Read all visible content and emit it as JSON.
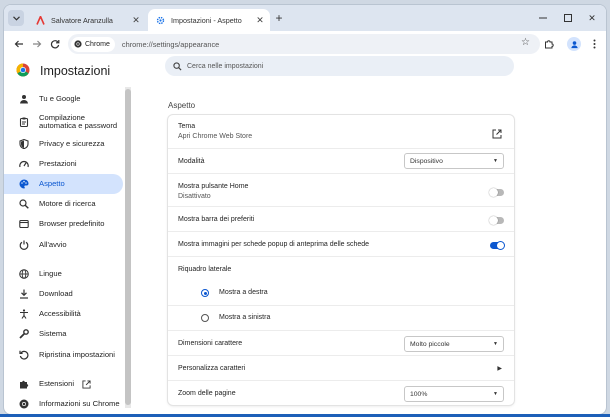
{
  "browser": {
    "tabs": [
      {
        "title": "Salvatore Aranzulla",
        "active": false
      },
      {
        "title": "Impostazioni - Aspetto",
        "active": true
      }
    ],
    "new_tab": "+",
    "address": {
      "chip_label": "Chrome",
      "url": "chrome://settings/appearance"
    }
  },
  "settings": {
    "app_title": "Impostazioni",
    "search_placeholder": "Cerca nelle impostazioni",
    "nav": [
      {
        "label": "Tu e Google",
        "icon": "person-icon"
      },
      {
        "label": "Compilazione automatica e password",
        "icon": "clipboard-icon"
      },
      {
        "label": "Privacy e sicurezza",
        "icon": "shield-icon"
      },
      {
        "label": "Prestazioni",
        "icon": "speedometer-icon"
      },
      {
        "label": "Aspetto",
        "icon": "palette-icon",
        "active": true
      },
      {
        "label": "Motore di ricerca",
        "icon": "search-icon"
      },
      {
        "label": "Browser predefinito",
        "icon": "browser-icon"
      },
      {
        "label": "All'avvio",
        "icon": "power-icon"
      },
      {
        "label": "Lingue",
        "icon": "globe-icon"
      },
      {
        "label": "Download",
        "icon": "download-icon"
      },
      {
        "label": "Accessibilità",
        "icon": "accessibility-icon"
      },
      {
        "label": "Sistema",
        "icon": "wrench-icon"
      },
      {
        "label": "Ripristina impostazioni",
        "icon": "reset-icon"
      },
      {
        "label": "Estensioni",
        "icon": "puzzle-icon"
      },
      {
        "label": "Informazioni su Chrome",
        "icon": "chrome-icon"
      }
    ],
    "section_title": "Aspetto",
    "theme": {
      "label": "Tema",
      "sub": "Apri Chrome Web Store"
    },
    "mode": {
      "label": "Modalità",
      "value": "Dispositivo"
    },
    "home_button": {
      "label": "Mostra pulsante Home",
      "sub": "Disattivato",
      "enabled": false
    },
    "bookmarks_bar": {
      "label": "Mostra barra dei preferiti",
      "enabled": false
    },
    "tab_previews": {
      "label": "Mostra immagini per schede popup di anteprima delle schede",
      "enabled": true
    },
    "side_panel": {
      "label": "Riquadro laterale",
      "options": [
        {
          "label": "Mostra a destra",
          "selected": true
        },
        {
          "label": "Mostra a sinistra",
          "selected": false
        }
      ]
    },
    "font_size": {
      "label": "Dimensioni carattere",
      "value": "Molto piccole"
    },
    "customize_fonts": {
      "label": "Personalizza caratteri"
    },
    "page_zoom": {
      "label": "Zoom delle pagine",
      "value": "100%"
    }
  },
  "colors": {
    "accent": "#0b57d0",
    "active_nav_bg": "#d3e3fd"
  }
}
